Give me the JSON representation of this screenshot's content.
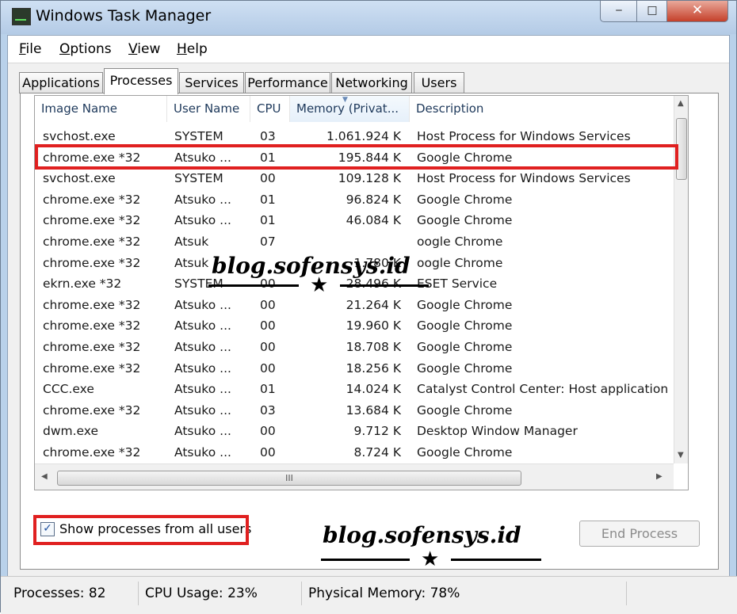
{
  "window": {
    "title": "Windows Task Manager",
    "min_label": "‒",
    "max_label": "□",
    "close_label": "✕"
  },
  "menu": [
    {
      "label": "File",
      "accel": "F",
      "rest": "ile"
    },
    {
      "label": "Options",
      "accel": "O",
      "rest": "ptions"
    },
    {
      "label": "View",
      "accel": "V",
      "rest": "iew"
    },
    {
      "label": "Help",
      "accel": "H",
      "rest": "elp"
    }
  ],
  "tabs": [
    "Applications",
    "Processes",
    "Services",
    "Performance",
    "Networking",
    "Users"
  ],
  "active_tab": "Processes",
  "columns": [
    "Image Name",
    "User Name",
    "CPU",
    "Memory (Privat...",
    "Description"
  ],
  "sorted_column": "Memory (Privat...",
  "rows": [
    {
      "name": "svchost.exe",
      "user": "SYSTEM",
      "cpu": "03",
      "mem": "1.061.924 K",
      "desc": "Host Process for Windows Services"
    },
    {
      "name": "chrome.exe *32",
      "user": "Atsuko ...",
      "cpu": "01",
      "mem": "195.844 K",
      "desc": "Google Chrome"
    },
    {
      "name": "svchost.exe",
      "user": "SYSTEM",
      "cpu": "00",
      "mem": "109.128 K",
      "desc": "Host Process for Windows Services"
    },
    {
      "name": "chrome.exe *32",
      "user": "Atsuko ...",
      "cpu": "01",
      "mem": "96.824 K",
      "desc": "Google Chrome"
    },
    {
      "name": "chrome.exe *32",
      "user": "Atsuko ...",
      "cpu": "01",
      "mem": "46.084 K",
      "desc": "Google Chrome"
    },
    {
      "name": "chrome.exe *32",
      "user": "Atsuk",
      "cpu": "07",
      "mem": "",
      "desc": "oogle Chrome"
    },
    {
      "name": "chrome.exe *32",
      "user": "Atsuk",
      "cpu": "",
      "mem": "1.780 K",
      "desc": "oogle Chrome"
    },
    {
      "name": "ekrn.exe *32",
      "user": "SYSTEM",
      "cpu": "00",
      "mem": "28.496 K",
      "desc": "ESET Service"
    },
    {
      "name": "chrome.exe *32",
      "user": "Atsuko ...",
      "cpu": "00",
      "mem": "21.264 K",
      "desc": "Google Chrome"
    },
    {
      "name": "chrome.exe *32",
      "user": "Atsuko ...",
      "cpu": "00",
      "mem": "19.960 K",
      "desc": "Google Chrome"
    },
    {
      "name": "chrome.exe *32",
      "user": "Atsuko ...",
      "cpu": "00",
      "mem": "18.708 K",
      "desc": "Google Chrome"
    },
    {
      "name": "chrome.exe *32",
      "user": "Atsuko ...",
      "cpu": "00",
      "mem": "18.256 K",
      "desc": "Google Chrome"
    },
    {
      "name": "CCC.exe",
      "user": "Atsuko ...",
      "cpu": "01",
      "mem": "14.024 K",
      "desc": "Catalyst Control Center: Host application"
    },
    {
      "name": "chrome.exe *32",
      "user": "Atsuko ...",
      "cpu": "03",
      "mem": "13.684 K",
      "desc": "Google Chrome"
    },
    {
      "name": "dwm.exe",
      "user": "Atsuko ...",
      "cpu": "00",
      "mem": "9.712 K",
      "desc": "Desktop Window Manager"
    },
    {
      "name": "chrome.exe *32",
      "user": "Atsuko ...",
      "cpu": "00",
      "mem": "8.724 K",
      "desc": "Google Chrome"
    }
  ],
  "show_all": {
    "label": "Show processes from all users",
    "checked": true,
    "check_glyph": "✓"
  },
  "end_process": "End Process",
  "status": {
    "processes": "Processes: 82",
    "cpu": "CPU Usage: 23%",
    "memory": "Physical Memory: 78%"
  },
  "watermark": {
    "text": "blog.sofensys.id",
    "star": "★"
  },
  "scrollbar": {
    "h_thumb_glyph": "III",
    "up": "▲",
    "down": "▼",
    "left": "◀",
    "right": "▶"
  },
  "colors": {
    "highlight": "#e02020",
    "title_bg": "#b9d1ea",
    "close": "#c5402a"
  }
}
